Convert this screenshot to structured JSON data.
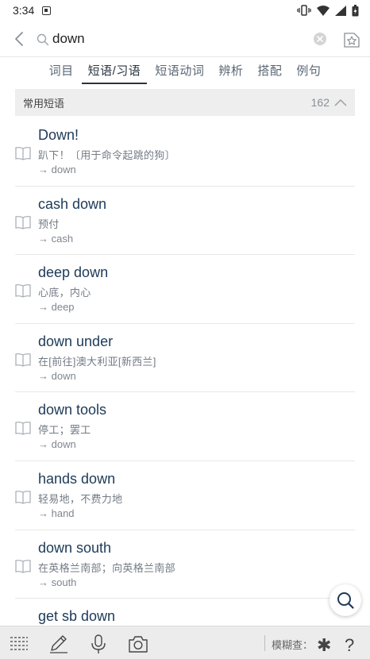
{
  "status": {
    "time": "3:34"
  },
  "search": {
    "query": "down"
  },
  "tabs": [
    {
      "label": "词目"
    },
    {
      "label": "短语/习语"
    },
    {
      "label": "短语动词"
    },
    {
      "label": "辨析"
    },
    {
      "label": "搭配"
    },
    {
      "label": "例句"
    }
  ],
  "section": {
    "title": "常用短语",
    "count": "162"
  },
  "items": [
    {
      "word": "Down!",
      "meaning": "趴下！〔用于命令起跳的狗〕",
      "ref": "→ down"
    },
    {
      "word": "cash down",
      "meaning": "预付",
      "ref": "→ cash"
    },
    {
      "word": "deep down",
      "meaning": "心底，内心",
      "ref": "→ deep"
    },
    {
      "word": "down under",
      "meaning": "在[前往]澳大利亚[新西兰]",
      "ref": "→ down"
    },
    {
      "word": "down tools",
      "meaning": "停工；罢工",
      "ref": "→ down"
    },
    {
      "word": "hands down",
      "meaning": "轻易地，不费力地",
      "ref": "→ hand"
    },
    {
      "word": "down south",
      "meaning": "在英格兰南部；向英格兰南部",
      "ref": "→ south"
    },
    {
      "word": "get sb down",
      "meaning": "",
      "ref": ""
    }
  ],
  "bottom": {
    "fuzzy_label": "模糊查：",
    "wildcard_star": "✱",
    "wildcard_question": "?"
  },
  "icons": [
    "back-icon",
    "search-icon",
    "clear-icon",
    "star-icon",
    "book-icon",
    "search-fab-icon",
    "menu-icon",
    "pen-icon",
    "mic-icon",
    "camera-icon"
  ],
  "colors": {
    "accent": "#1d3a57",
    "tab_active": "#2a3440",
    "section_bg": "#eeeeee"
  }
}
